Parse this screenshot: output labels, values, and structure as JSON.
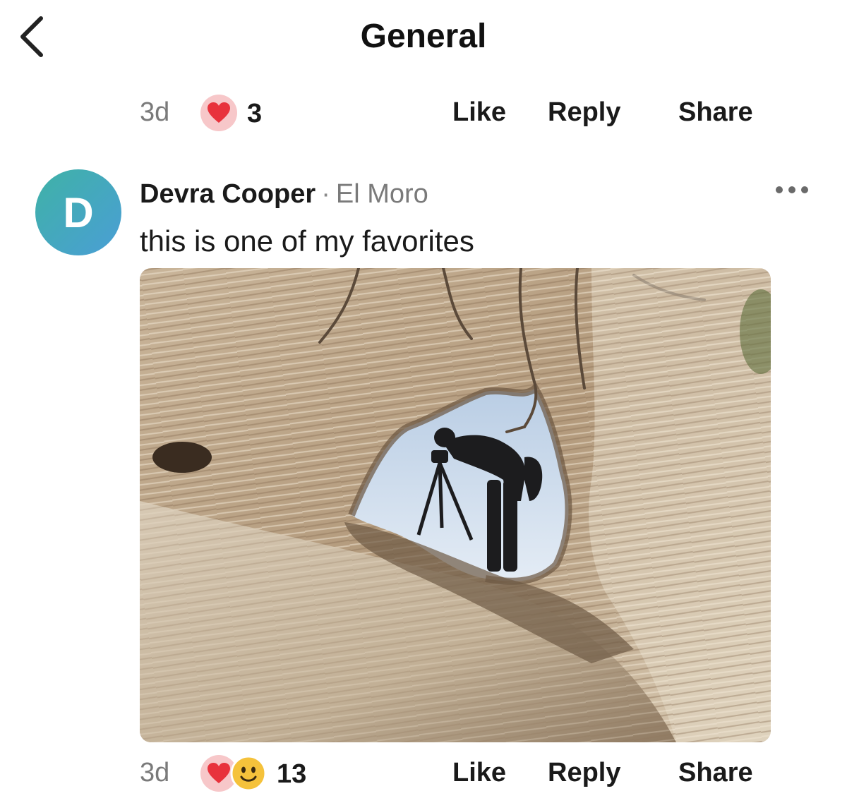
{
  "header": {
    "title": "General",
    "back_icon": "chevron-left-icon"
  },
  "previous_comment": {
    "time": "3d",
    "reactions": [
      "heart"
    ],
    "reaction_count": "3",
    "like_label": "Like",
    "reply_label": "Reply",
    "share_label": "Share"
  },
  "comment": {
    "avatar_letter": "D",
    "author": "Devra Cooper",
    "separator": "·",
    "place": "El Moro",
    "text": "this is one of my favorites",
    "more_icon": "more-horizontal-icon",
    "photo": "photographer with tripod seen through rock arch",
    "time": "3d",
    "reactions": [
      "heart",
      "smile"
    ],
    "reaction_count": "13",
    "like_label": "Like",
    "reply_label": "Reply",
    "share_label": "Share"
  },
  "colors": {
    "text": "#1a1a1a",
    "muted": "#7a7a7a",
    "heart": "#e8323c",
    "heart_bubble": "#f7c7c9",
    "smile": "#f5c23b",
    "avatar_start": "#3fb2a6",
    "avatar_end": "#4a9ed6"
  }
}
